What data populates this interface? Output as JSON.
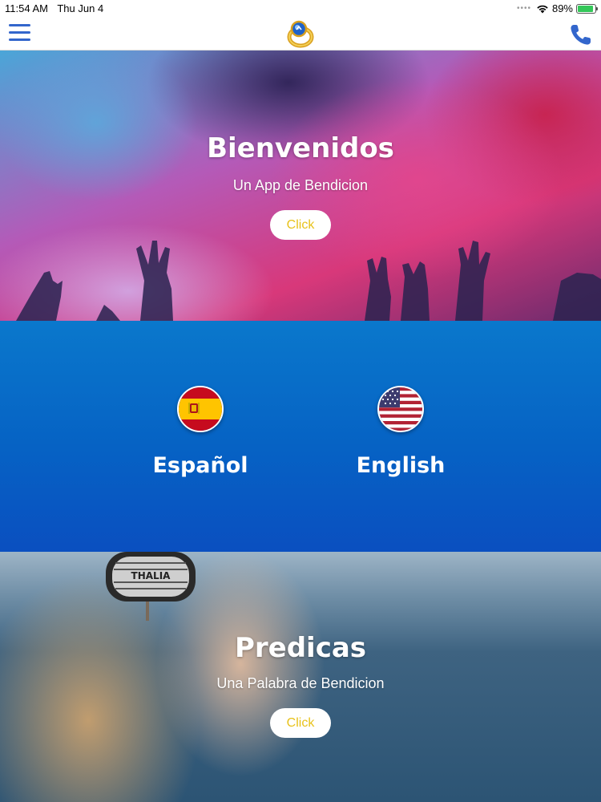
{
  "status_bar": {
    "time": "11:54 AM",
    "date": "Thu Jun 4",
    "battery_percent": "89%",
    "battery_level": 0.89
  },
  "nav": {
    "menu_icon": "hamburger-icon",
    "logo_icon": "ring-logo-icon",
    "phone_icon": "phone-icon",
    "accent_color": "#3366cc"
  },
  "hero_top": {
    "title": "Bienvenidos",
    "subtitle": "Un App de Bendicion",
    "button_label": "Click"
  },
  "languages": [
    {
      "label": "Español",
      "flag_icon": "spain-flag-icon"
    },
    {
      "label": "English",
      "flag_icon": "usa-flag-icon"
    }
  ],
  "hero_bottom": {
    "title": "Predicas",
    "subtitle": "Una Palabra de Bendicion",
    "button_label": "Click",
    "headphone_brand": "THALIA"
  },
  "colors": {
    "button_text": "#e8c21a",
    "lang_section": "#0662c4"
  }
}
